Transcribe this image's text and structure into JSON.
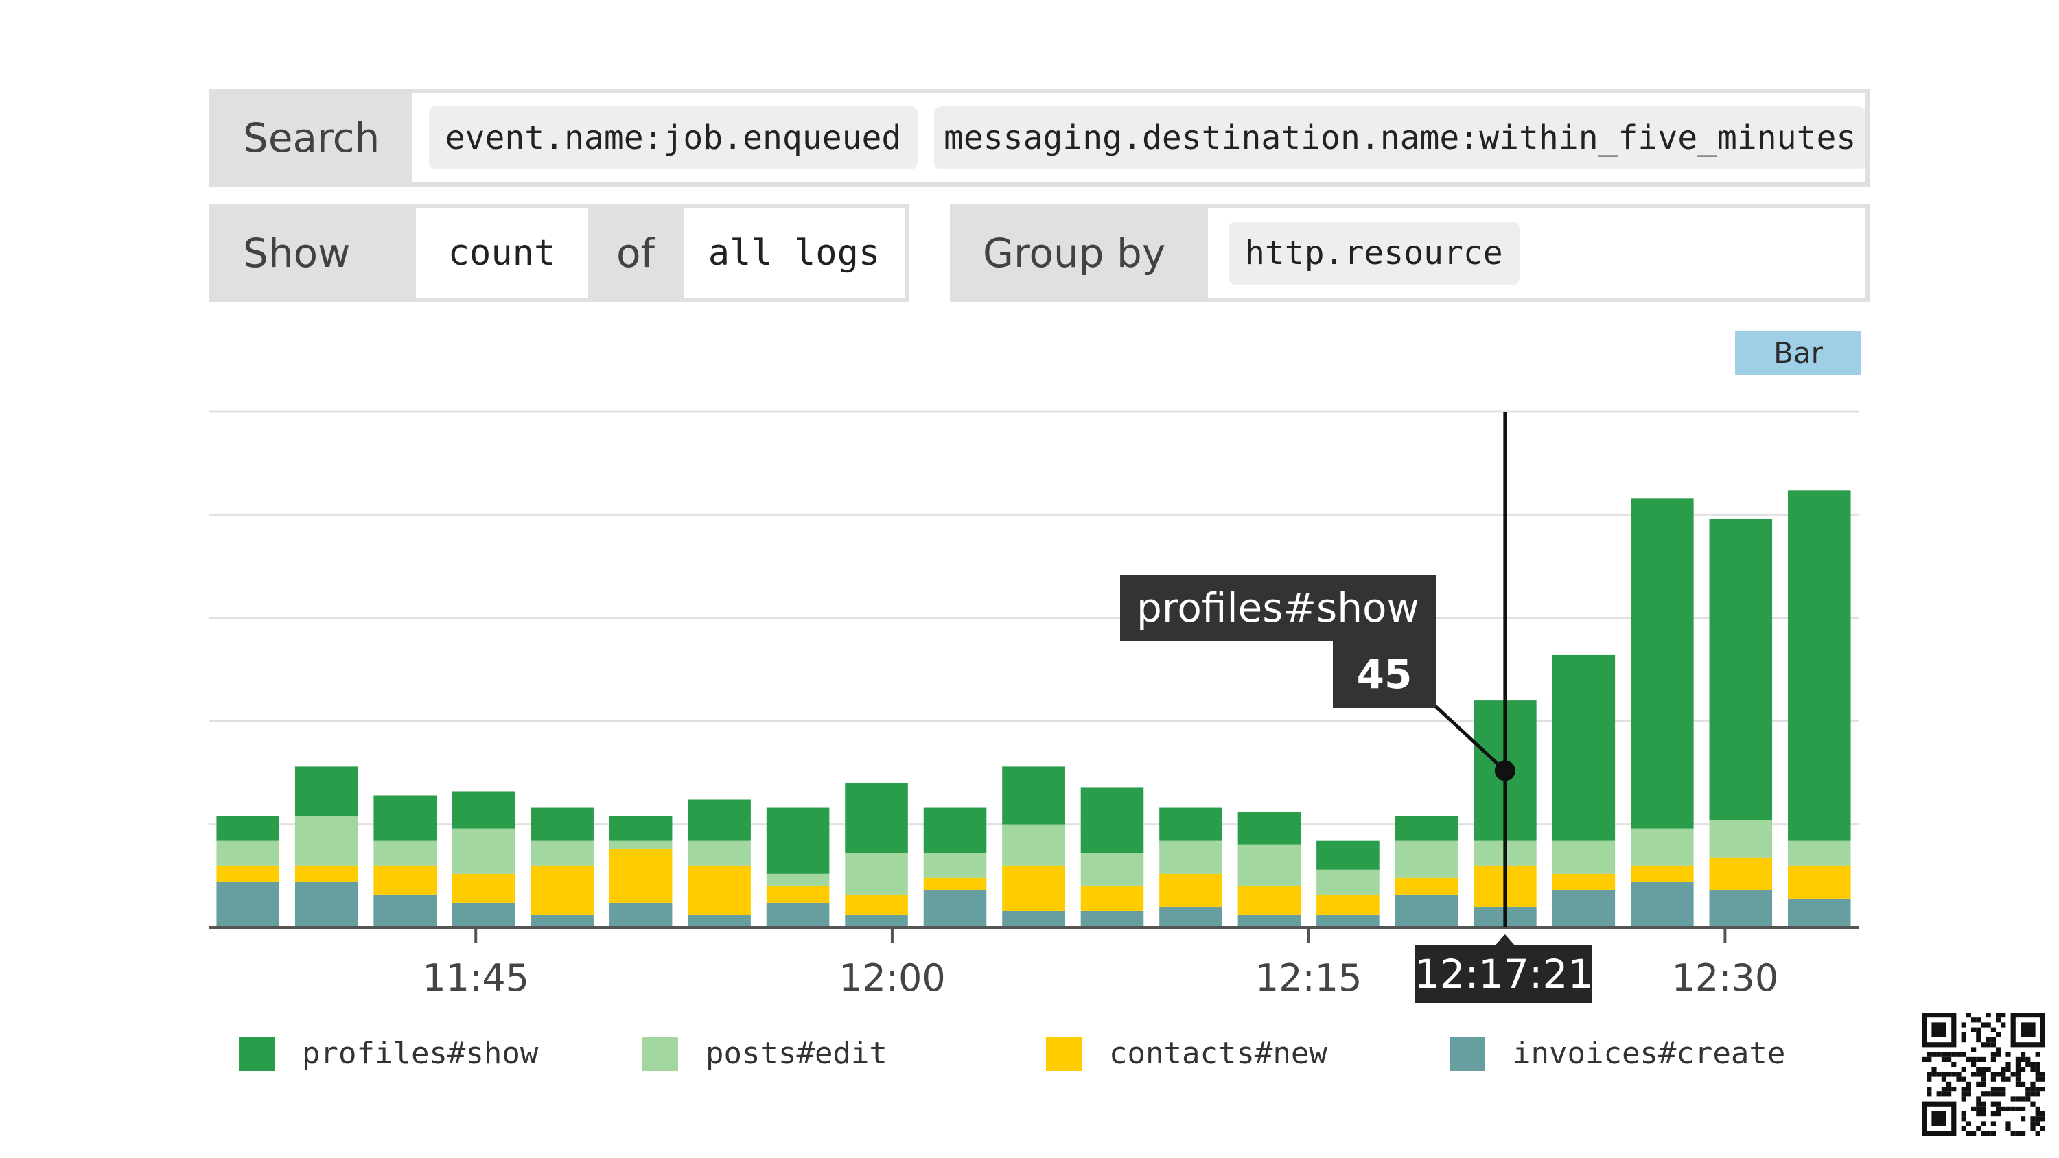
{
  "query": {
    "search_label": "Search",
    "search_terms": [
      "event.name:job.enqueued",
      "messaging.destination.name:within_five_minutes"
    ],
    "show_label": "Show",
    "aggregation": "count",
    "of_label": "of",
    "source": "all logs",
    "group_by_label": "Group by",
    "group_by_value": "http.resource",
    "chart_type": "Bar"
  },
  "colors": {
    "profiles#show": "#2a9d4a",
    "posts#edit": "#a3d7a0",
    "contacts#new": "#ffcc00",
    "invoices#create": "#679e9f",
    "tooltip_bg": "#333333",
    "grid": "#e0e0e0"
  },
  "tooltip": {
    "series": "profiles#show",
    "value": "45"
  },
  "cursor_time": "12:17:21",
  "chart_data": {
    "type": "bar",
    "stacked": true,
    "title": "",
    "xlabel": "",
    "ylabel": "",
    "x_tick_labels": [
      "11:45",
      "12:00",
      "12:15",
      "12:30"
    ],
    "x_tick_bar_index": [
      2.9,
      8.2,
      13.5,
      18.8
    ],
    "ylim": [
      0,
      125
    ],
    "yticks": [
      0,
      25,
      50,
      75,
      100,
      125
    ],
    "grid": true,
    "legend_position": "bottom",
    "series": [
      {
        "name": "invoices#create",
        "values": [
          11,
          11,
          8,
          6,
          3,
          6,
          3,
          6,
          3,
          9,
          4,
          4,
          5,
          3,
          3,
          8,
          5,
          9,
          11,
          9,
          7
        ]
      },
      {
        "name": "contacts#new",
        "values": [
          4,
          4,
          7,
          7,
          12,
          13,
          12,
          4,
          5,
          3,
          11,
          6,
          8,
          7,
          5,
          4,
          10,
          4,
          4,
          8,
          8
        ]
      },
      {
        "name": "posts#edit",
        "values": [
          6,
          12,
          6,
          11,
          6,
          2,
          6,
          3,
          10,
          6,
          10,
          8,
          8,
          10,
          6,
          9,
          6,
          8,
          9,
          9,
          6
        ]
      },
      {
        "name": "profiles#show",
        "values": [
          6,
          12,
          11,
          9,
          8,
          6,
          10,
          16,
          17,
          11,
          14,
          16,
          8,
          8,
          7,
          6,
          34,
          45,
          80,
          73,
          85
        ]
      }
    ]
  }
}
